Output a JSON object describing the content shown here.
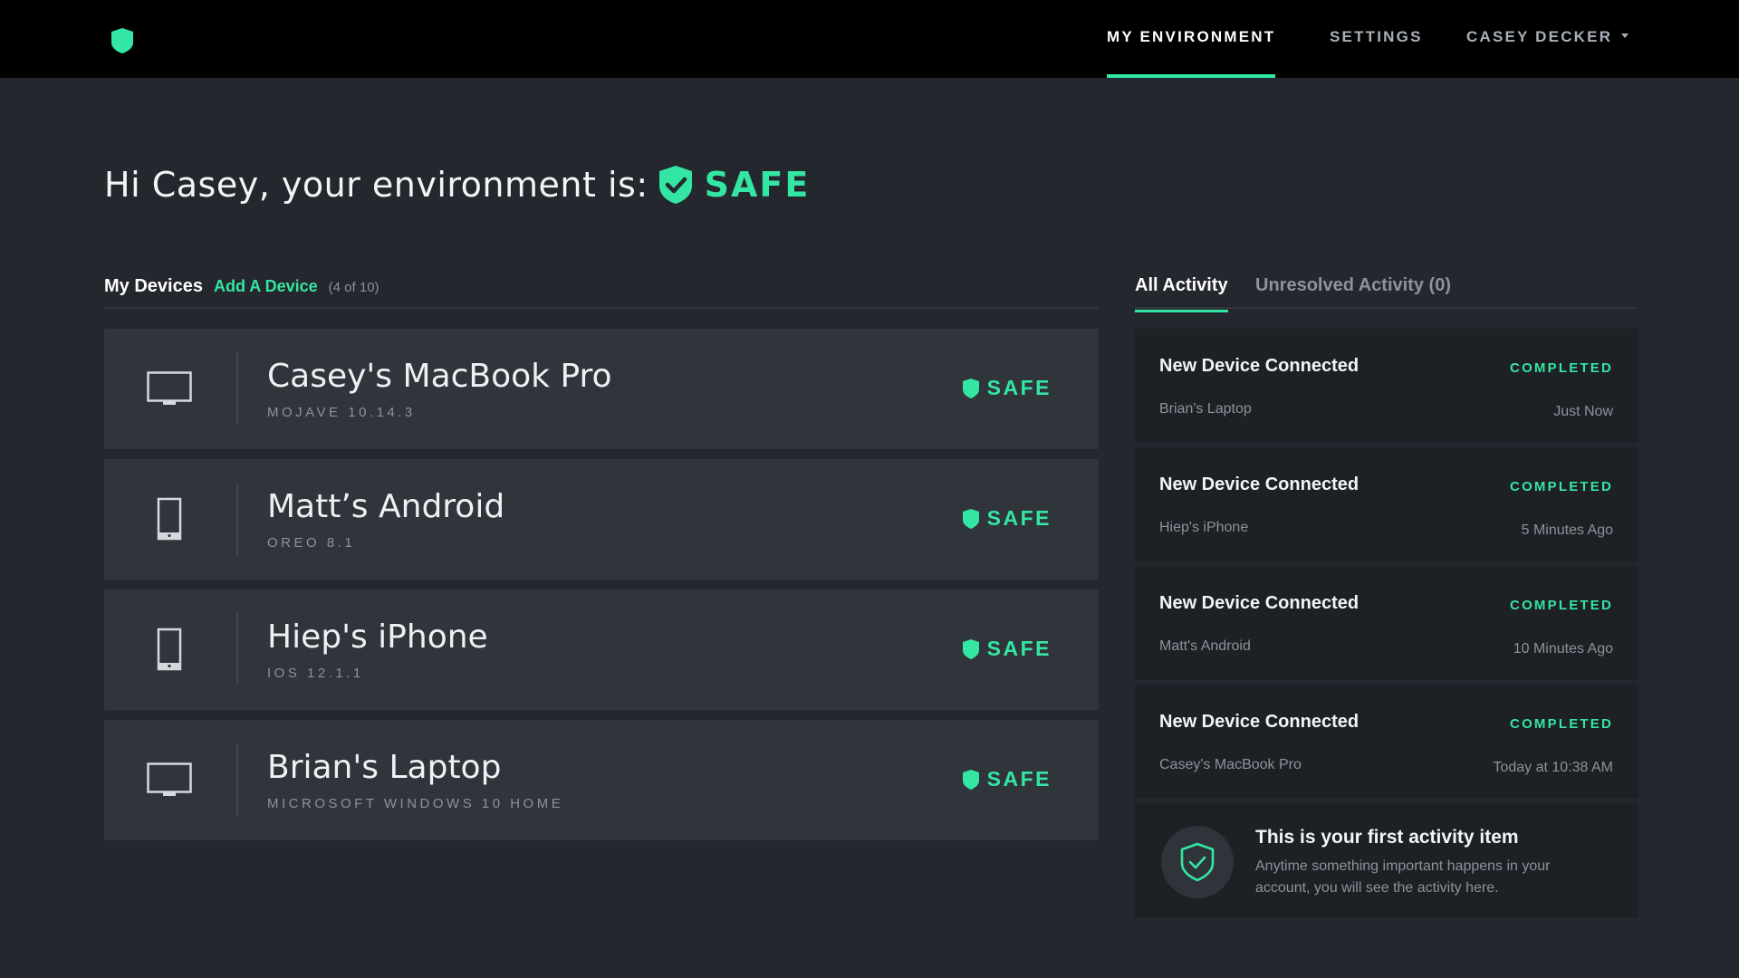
{
  "colors": {
    "accent": "#34e6a3",
    "background": "#24272d",
    "topbar": "#000000",
    "card": "#30343b",
    "activity_card": "#1d2025"
  },
  "header": {
    "logo_icon": "shield-icon",
    "nav": {
      "environment": "MY ENVIRONMENT",
      "settings": "SETTINGS",
      "user": "CASEY DECKER"
    },
    "active_tab": "environment"
  },
  "greeting": {
    "text": "Hi Casey, your environment is:",
    "status_icon": "shield-check-icon",
    "status": "SAFE"
  },
  "devices": {
    "title": "My Devices",
    "add_label": "Add A Device",
    "count": "(4 of 10)",
    "items": [
      {
        "name": "Casey's MacBook Pro",
        "os": "MOJAVE 10.14.3",
        "type": "desktop",
        "icon": "monitor-icon",
        "status": "SAFE"
      },
      {
        "name": "Matt’s Android",
        "os": "OREO 8.1",
        "type": "phone",
        "icon": "phone-icon",
        "status": "SAFE"
      },
      {
        "name": "Hiep's iPhone",
        "os": "IOS 12.1.1",
        "type": "phone",
        "icon": "phone-icon",
        "status": "SAFE"
      },
      {
        "name": "Brian's Laptop",
        "os": "MICROSOFT WINDOWS 10 HOME",
        "type": "desktop",
        "icon": "monitor-icon",
        "status": "SAFE"
      }
    ]
  },
  "activity": {
    "tabs": {
      "all": "All Activity",
      "unresolved": "Unresolved Activity (0)"
    },
    "items": [
      {
        "title": "New Device Connected",
        "status": "COMPLETED",
        "device": "Brian's Laptop",
        "time": "Just Now"
      },
      {
        "title": "New Device Connected",
        "status": "COMPLETED",
        "device": "Hiep's iPhone",
        "time": "5 Minutes Ago"
      },
      {
        "title": "New Device Connected",
        "status": "COMPLETED",
        "device": "Matt's Android",
        "time": "10 Minutes Ago"
      },
      {
        "title": "New Device Connected",
        "status": "COMPLETED",
        "device": "Casey's MacBook Pro",
        "time": "Today at 10:38 AM"
      }
    ],
    "first_item": {
      "icon": "shield-check-icon",
      "title": "This is your first activity item",
      "description": "Anytime something important happens in your account, you will see the activity here."
    }
  }
}
